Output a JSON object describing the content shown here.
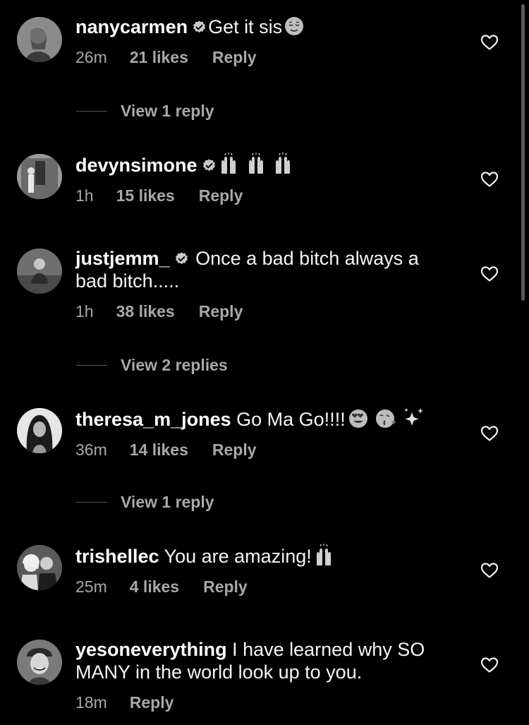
{
  "comments": [
    {
      "username": "nanycarmen",
      "verified": true,
      "text": "Get it sis",
      "emoji": [
        "relieved-face"
      ],
      "time": "26m",
      "likes": "21 likes",
      "reply_label": "Reply",
      "view_replies": "View 1 reply"
    },
    {
      "username": "devynsimone",
      "verified": true,
      "text": "",
      "emoji": [
        "raising-hands",
        "raising-hands",
        "raising-hands"
      ],
      "time": "1h",
      "likes": "15 likes",
      "reply_label": "Reply",
      "view_replies": ""
    },
    {
      "username": "justjemm_",
      "verified": true,
      "text": "Once a bad bitch always a bad bitch.....",
      "emoji": [],
      "time": "1h",
      "likes": "38 likes",
      "reply_label": "Reply",
      "view_replies": "View 2 replies"
    },
    {
      "username": "theresa_m_jones",
      "verified": false,
      "text": "Go Ma Go!!!!",
      "emoji": [
        "heart-eyes",
        "kissing-face",
        "sparkles"
      ],
      "time": "36m",
      "likes": "14 likes",
      "reply_label": "Reply",
      "view_replies": "View 1 reply"
    },
    {
      "username": "trishellec",
      "verified": false,
      "text": "You are amazing!",
      "emoji": [
        "raising-hands"
      ],
      "time": "25m",
      "likes": "4 likes",
      "reply_label": "Reply",
      "view_replies": ""
    },
    {
      "username": "yesoneverything",
      "verified": false,
      "text": "I have learned why SO MANY in the world look up to you.",
      "emoji": [],
      "time": "18m",
      "likes": "",
      "reply_label": "Reply",
      "view_replies": ""
    }
  ],
  "colors": {
    "background": "#000000",
    "primary_text": "#f5f5f5",
    "secondary_text": "#a8a8a8",
    "verified_badge": "#c8c8c8"
  },
  "icons": {
    "like": "heart-outline-icon",
    "verified": "verified-badge-icon"
  }
}
